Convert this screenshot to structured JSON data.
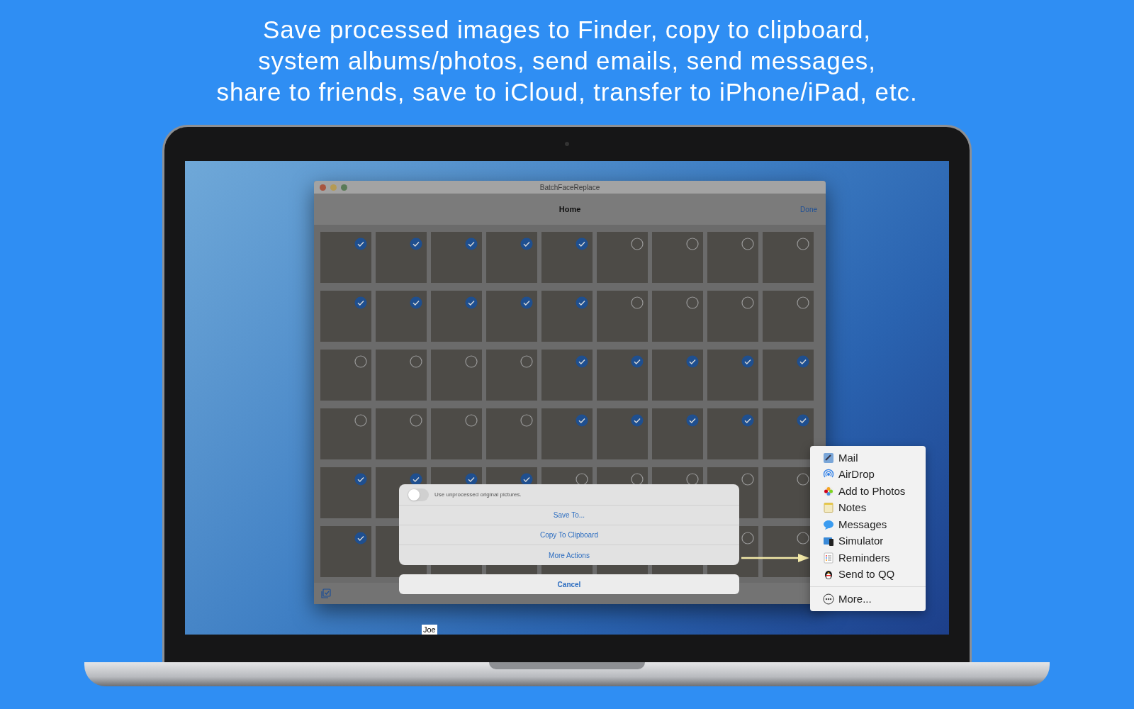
{
  "headline": [
    "Save processed images to Finder, copy to clipboard,",
    "system albums/photos, send emails, send messages,",
    "share to friends, save to iCloud, transfer to iPhone/iPad, etc."
  ],
  "window": {
    "title": "BatchFaceReplace",
    "nav_title": "Home",
    "done": "Done"
  },
  "photo_rows": [
    {
      "photos": [
        {
          "checked": true
        },
        {
          "checked": true
        },
        {
          "checked": true
        },
        {
          "checked": true
        },
        {
          "checked": true
        },
        {
          "checked": false
        },
        {
          "checked": false
        },
        {
          "checked": false
        },
        {
          "checked": false
        }
      ]
    },
    {
      "photos": [
        {
          "checked": true
        },
        {
          "checked": true
        },
        {
          "checked": true
        },
        {
          "checked": true
        },
        {
          "checked": true
        },
        {
          "checked": false
        },
        {
          "checked": false
        },
        {
          "checked": false
        },
        {
          "checked": false
        }
      ]
    },
    {
      "photos": [
        {
          "checked": false
        },
        {
          "checked": false
        },
        {
          "checked": false
        },
        {
          "checked": false
        },
        {
          "checked": true
        },
        {
          "checked": true
        },
        {
          "checked": true
        },
        {
          "checked": true
        },
        {
          "checked": true
        }
      ]
    },
    {
      "photos": [
        {
          "checked": false
        },
        {
          "checked": false
        },
        {
          "checked": false
        },
        {
          "checked": false
        },
        {
          "checked": true
        },
        {
          "checked": true
        },
        {
          "checked": true
        },
        {
          "checked": true
        },
        {
          "checked": true
        }
      ]
    },
    {
      "photos": [
        {
          "checked": true
        },
        {
          "checked": true
        },
        {
          "checked": true
        },
        {
          "checked": true
        },
        {
          "checked": false
        },
        {
          "checked": false
        },
        {
          "checked": false
        },
        {
          "checked": false
        },
        {
          "checked": false
        }
      ]
    },
    {
      "photos": [
        {
          "checked": true
        },
        {
          "checked": false
        },
        {
          "checked": false
        }
      ]
    }
  ],
  "action_sheet": {
    "toggle": {
      "label": "Use unprocessed original pictures.",
      "on": false
    },
    "actions": [
      "Save To...",
      "Copy To Clipboard",
      "More Actions"
    ],
    "cancel": "Cancel"
  },
  "share_menu": {
    "items": [
      {
        "kind": "mail",
        "label": "Mail"
      },
      {
        "kind": "airdrop",
        "label": "AirDrop"
      },
      {
        "kind": "photos",
        "label": "Add to Photos"
      },
      {
        "kind": "notes",
        "label": "Notes"
      },
      {
        "kind": "messages",
        "label": "Messages"
      },
      {
        "kind": "simulator",
        "label": "Simulator"
      },
      {
        "kind": "reminders",
        "label": "Reminders"
      },
      {
        "kind": "qq",
        "label": "Send to QQ"
      }
    ],
    "more": "More..."
  },
  "desktop_label": "Joe"
}
